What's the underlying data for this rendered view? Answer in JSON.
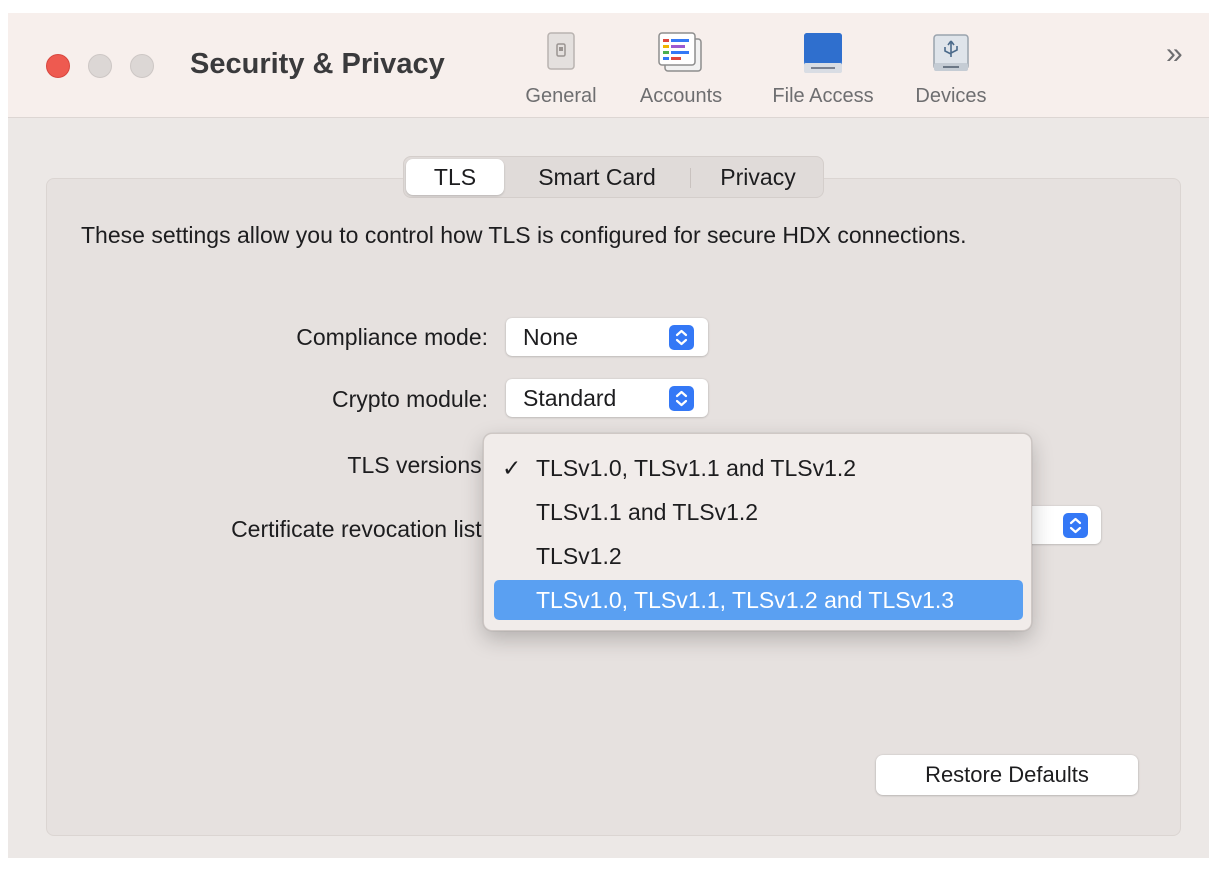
{
  "window": {
    "title": "Security & Privacy",
    "overflow_glyph": "»"
  },
  "toolbar": {
    "items": [
      {
        "label": "General",
        "icon": "general-icon"
      },
      {
        "label": "Accounts",
        "icon": "accounts-icon"
      },
      {
        "label": "File Access",
        "icon": "file-access-icon"
      },
      {
        "label": "Devices",
        "icon": "devices-icon"
      }
    ]
  },
  "tabs": [
    {
      "label": "TLS",
      "selected": true
    },
    {
      "label": "Smart Card",
      "selected": false
    },
    {
      "label": "Privacy",
      "selected": false
    }
  ],
  "description": "These settings allow you to control how TLS is configured for secure HDX connections.",
  "fields": {
    "compliance_mode": {
      "label": "Compliance mode:",
      "value": "None"
    },
    "crypto_module": {
      "label": "Crypto module:",
      "value": "Standard"
    },
    "tls_versions": {
      "label": "TLS versions:"
    },
    "certificate_revocation_list": {
      "label": "Certificate revocation list:"
    }
  },
  "tls_menu": {
    "checkmark": "✓",
    "options": [
      {
        "label": "TLSv1.0, TLSv1.1 and TLSv1.2",
        "checked": true,
        "highlighted": false
      },
      {
        "label": "TLSv1.1 and TLSv1.2",
        "checked": false,
        "highlighted": false
      },
      {
        "label": "TLSv1.2",
        "checked": false,
        "highlighted": false
      },
      {
        "label": "TLSv1.0, TLSv1.1, TLSv1.2 and TLSv1.3",
        "checked": false,
        "highlighted": true
      }
    ]
  },
  "buttons": {
    "restore_defaults": "Restore Defaults"
  },
  "colors": {
    "accent": "#3478f6",
    "highlight": "#5aa0f2",
    "close": "#ee5a50"
  }
}
